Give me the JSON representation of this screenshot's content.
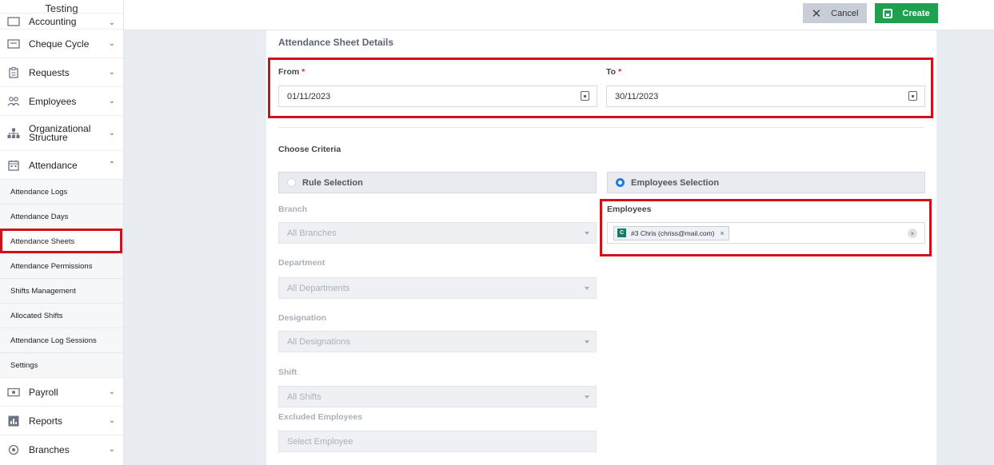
{
  "sidebar": {
    "title": "Testing",
    "items_top": [
      {
        "label": "Accounting",
        "icon": "accounting-icon"
      },
      {
        "label": "Cheque Cycle",
        "icon": "cheque-icon"
      },
      {
        "label": "Requests",
        "icon": "clipboard-icon"
      },
      {
        "label": "Employees",
        "icon": "users-icon"
      },
      {
        "label": "Organizational Structure",
        "line1": "Organizational",
        "line2": "Structure",
        "icon": "org-chart-icon"
      },
      {
        "label": "Attendance",
        "icon": "calendar-icon"
      }
    ],
    "attendance_sub": [
      "Attendance Logs",
      "Attendance Days",
      "Attendance Sheets",
      "Attendance Permissions",
      "Shifts Management",
      "Allocated Shifts",
      "Attendance Log Sessions",
      "Settings"
    ],
    "items_bottom": [
      {
        "label": "Payroll",
        "icon": "payroll-icon"
      },
      {
        "label": "Reports",
        "icon": "reports-icon"
      },
      {
        "label": "Branches",
        "icon": "branches-icon"
      }
    ]
  },
  "toolbar": {
    "cancel_label": "Cancel",
    "create_label": "Create"
  },
  "form": {
    "title": "Attendance Sheet Details",
    "from_label": "From",
    "to_label": "To",
    "required_mark": "*",
    "from_value": "01/11/2023",
    "to_value": "30/11/2023",
    "criteria_label": "Choose Criteria",
    "rule_selection": "Rule Selection",
    "employees_selection": "Employees Selection",
    "branch_label": "Branch",
    "branch_value": "All Branches",
    "department_label": "Department",
    "department_value": "All Departments",
    "designation_label": "Designation",
    "designation_value": "All Designations",
    "shift_label": "Shift",
    "shift_value": "All Shifts",
    "excluded_label": "Excluded Employees",
    "excluded_placeholder": "Select Employee",
    "employees_label": "Employees",
    "employee_chip": {
      "avatar": "C",
      "text": "#3 Chris (chriss@mail.com)",
      "remove": "×"
    },
    "clear_all": "×"
  },
  "colors": {
    "create_button": "#1fa04f",
    "cancel_button": "#c7ced8",
    "highlight": "#d0111b",
    "radio_active": "#1e7be6"
  }
}
